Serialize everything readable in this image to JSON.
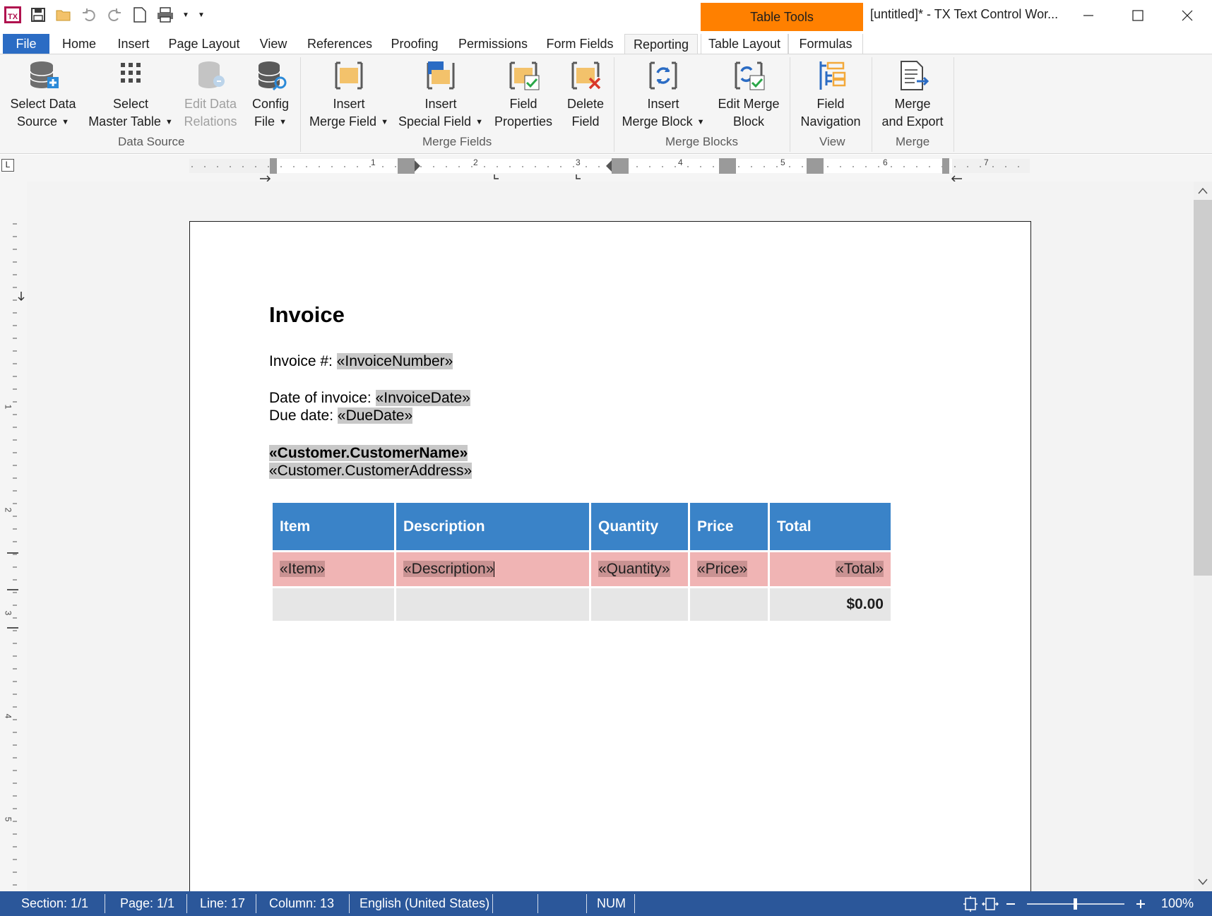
{
  "app": {
    "window_title": "[untitled]* - TX Text Control Wor...",
    "contextual_tab_header": "Table Tools"
  },
  "tabs": [
    "File",
    "Home",
    "Insert",
    "Page Layout",
    "View",
    "References",
    "Proofing",
    "Permissions",
    "Form Fields",
    "Reporting",
    "Table Layout",
    "Formulas"
  ],
  "active_tab": "Reporting",
  "ribbon": {
    "data_source": {
      "group_label": "Data Source",
      "select_data_source": [
        "Select Data",
        "Source"
      ],
      "select_master_table": [
        "Select",
        "Master Table"
      ],
      "edit_data_relations": [
        "Edit Data",
        "Relations"
      ],
      "config_file": [
        "Config",
        "File"
      ]
    },
    "merge_fields": {
      "group_label": "Merge Fields",
      "insert_merge_field": [
        "Insert",
        "Merge Field"
      ],
      "insert_special_field": [
        "Insert",
        "Special Field"
      ],
      "field_properties": [
        "Field",
        "Properties"
      ],
      "delete_field": [
        "Delete",
        "Field"
      ]
    },
    "merge_blocks": {
      "group_label": "Merge Blocks",
      "insert_merge_block": [
        "Insert",
        "Merge Block"
      ],
      "edit_merge_block": [
        "Edit Merge",
        "Block"
      ]
    },
    "view": {
      "group_label": "View",
      "field_navigation": [
        "Field",
        "Navigation"
      ]
    },
    "merge": {
      "group_label": "Merge",
      "merge_and_export": [
        "Merge",
        "and Export"
      ]
    }
  },
  "ruler": {
    "numbers": [
      "1",
      "2",
      "3",
      "4",
      "5",
      "6",
      "7"
    ],
    "vertical_numbers": [
      "1",
      "2",
      "3",
      "4",
      "5"
    ]
  },
  "document": {
    "title": "Invoice",
    "invoice_number_label": "Invoice #: ",
    "invoice_number_field": "«InvoiceNumber»",
    "invoice_date_label": "Date of invoice: ",
    "invoice_date_field": "«InvoiceDate»",
    "due_date_label": "Due date: ",
    "due_date_field": "«DueDate»",
    "customer_name_field": "«Customer.CustomerName»",
    "customer_address_field": "«Customer.CustomerAddress»",
    "table": {
      "headers": [
        "Item",
        "Description",
        "Quantity",
        "Price",
        "Total"
      ],
      "merge_row": [
        "«Item»",
        "«Description»",
        "«Quantity»",
        "«Price»",
        "«Total»"
      ],
      "total_value": "$0.00"
    }
  },
  "statusbar": {
    "section": "Section: 1/1",
    "page": "Page: 1/1",
    "line": "Line: 17",
    "column": "Column: 13",
    "language": "English (United States)",
    "num": "NUM",
    "zoom": "100%"
  },
  "colors": {
    "accent": "#2b6cc4",
    "context_tab": "#ff8000",
    "statusbar": "#2b579a",
    "table_header": "#3a83c8",
    "merge_row": "#f0b4b4"
  }
}
